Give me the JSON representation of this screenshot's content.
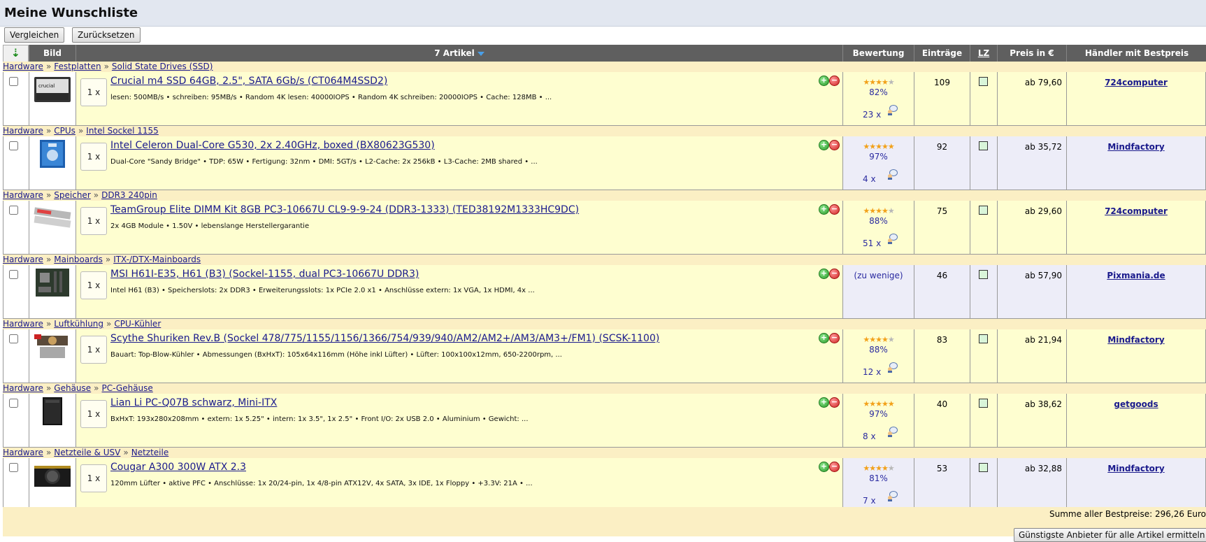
{
  "page": {
    "title": "Meine Wunschliste"
  },
  "toolbar": {
    "compare_label": "Vergleichen",
    "reset_label": "Zurücksetzen"
  },
  "header": {
    "sort_arrow": "⇣",
    "image": "Bild",
    "articles": "7 Artikel",
    "rating": "Bewertung",
    "entries": "Einträge",
    "lz": "LZ",
    "price": "Preis in €",
    "dealer": "Händler mit Bestpreis"
  },
  "items": [
    {
      "breadcrumb": [
        "Hardware",
        "Festplatten",
        "Solid State Drives (SSD)"
      ],
      "qty": "1 x",
      "name": "Crucial m4 SSD 64GB, 2.5\", SATA 6Gb/s (CT064M4SSD2)",
      "desc": "lesen: 500MB/s • schreiben: 95MB/s • Random 4K lesen: 40000IOPS • Random 4K schreiben: 20000IOPS • Cache: 128MB • ...",
      "stars": 4,
      "rating": "82%",
      "reviews": "23 x",
      "entries": "109",
      "price": "ab 79,60",
      "dealer": "724computer",
      "thumb": "ssd"
    },
    {
      "breadcrumb": [
        "Hardware",
        "CPUs",
        "Intel Sockel 1155"
      ],
      "qty": "1 x",
      "name": "Intel Celeron Dual-Core G530, 2x 2.40GHz, boxed (BX80623G530)",
      "desc": "Dual-Core \"Sandy Bridge\" • TDP: 65W • Fertigung: 32nm • DMI: 5GT/s • L2-Cache: 2x 256kB • L3-Cache: 2MB shared • ...",
      "stars": 5,
      "rating": "97%",
      "reviews": "4 x",
      "entries": "92",
      "price": "ab 35,72",
      "dealer": "Mindfactory",
      "thumb": "cpu"
    },
    {
      "breadcrumb": [
        "Hardware",
        "Speicher",
        "DDR3 240pin"
      ],
      "qty": "1 x",
      "name": "TeamGroup Elite DIMM Kit 8GB PC3-10667U CL9-9-9-24 (DDR3-1333) (TED38192M1333HC9DC)",
      "desc": "2x 4GB Module • 1.50V • lebenslange Herstellergarantie",
      "stars": 4,
      "rating": "88%",
      "reviews": "51 x",
      "entries": "75",
      "price": "ab 29,60",
      "dealer": "724computer",
      "thumb": "ram"
    },
    {
      "breadcrumb": [
        "Hardware",
        "Mainboards",
        "ITX-/DTX-Mainboards"
      ],
      "qty": "1 x",
      "name": "MSI H61I-E35, H61 (B3) (Sockel-1155, dual PC3-10667U DDR3)",
      "desc": "Intel H61 (B3) • Speicherslots: 2x DDR3 • Erweiterungsslots: 1x PCIe 2.0 x1 • Anschlüsse extern: 1x VGA, 1x HDMI, 4x ...",
      "stars": 0,
      "rating": "(zu wenige)",
      "reviews": "",
      "entries": "46",
      "price": "ab 57,90",
      "dealer": "Pixmania.de",
      "thumb": "board"
    },
    {
      "breadcrumb": [
        "Hardware",
        "Luftkühlung",
        "CPU-Kühler"
      ],
      "qty": "1 x",
      "name": "Scythe Shuriken Rev.B (Sockel 478/775/1155/1156/1366/754/939/940/AM2/AM2+/AM3/AM3+/FM1) (SCSK-1100)",
      "desc": "Bauart: Top-Blow-Kühler • Abmessungen (BxHxT): 105x64x116mm (Höhe inkl Lüfter) • Lüfter: 100x100x12mm, 650-2200rpm, ...",
      "stars": 4,
      "rating": "88%",
      "reviews": "12 x",
      "entries": "83",
      "price": "ab 21,94",
      "dealer": "Mindfactory",
      "thumb": "cooler"
    },
    {
      "breadcrumb": [
        "Hardware",
        "Gehäuse",
        "PC-Gehäuse"
      ],
      "qty": "1 x",
      "name": "Lian Li PC-Q07B schwarz, Mini-ITX",
      "desc": "BxHxT: 193x280x208mm • extern: 1x 5.25\" • intern: 1x 3.5\", 1x 2.5\" • Front I/O: 2x USB 2.0 • Aluminium • Gewicht: ...",
      "stars": 5,
      "rating": "97%",
      "reviews": "8 x",
      "entries": "40",
      "price": "ab 38,62",
      "dealer": "getgoods",
      "thumb": "case"
    },
    {
      "breadcrumb": [
        "Hardware",
        "Netzteile & USV",
        "Netzteile"
      ],
      "qty": "1 x",
      "name": "Cougar A300 300W ATX 2.3",
      "desc": "120mm Lüfter • aktive PFC • Anschlüsse: 1x 20/24-pin, 1x 4/8-pin ATX12V, 4x SATA, 3x IDE, 1x Floppy • +3.3V: 21A • ...",
      "stars": 4,
      "rating": "81%",
      "reviews": "7 x",
      "entries": "53",
      "price": "ab 32,88",
      "dealer": "Mindfactory",
      "thumb": "psu"
    }
  ],
  "footer": {
    "sum_label": "Summe aller Bestpreise: 296,26 Euro",
    "best_button": "Günstigste Anbieter für alle Artikel ermitteln"
  },
  "colors": {
    "header_bg": "#5f5f5f",
    "row_bg": "#fefed0",
    "crumb_bg": "#fbefc4",
    "link": "#1a1a8c"
  }
}
